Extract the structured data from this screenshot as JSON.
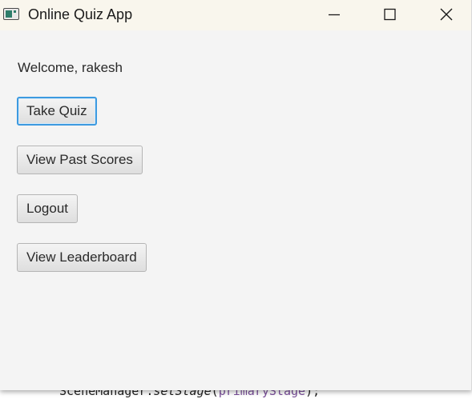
{
  "window": {
    "title": "Online Quiz App",
    "icon": "app-window-icon",
    "controls": [
      "minimize-icon",
      "maximize-icon",
      "close-icon"
    ]
  },
  "main": {
    "welcome_text": "Welcome, rakesh",
    "buttons": {
      "take_quiz": "Take Quiz",
      "view_past_scores": "View Past Scores",
      "logout": "Logout",
      "view_leaderboard": "View Leaderboard"
    }
  },
  "background": {
    "code_object": "SceneManager.",
    "code_method": "setStage",
    "code_open": "(",
    "code_arg": "primaryStage",
    "code_close": ");"
  },
  "colors": {
    "focus_ring": "#3d9ae0",
    "titlebar": "#f9f6ed",
    "window_bg": "#f4f4f4"
  }
}
